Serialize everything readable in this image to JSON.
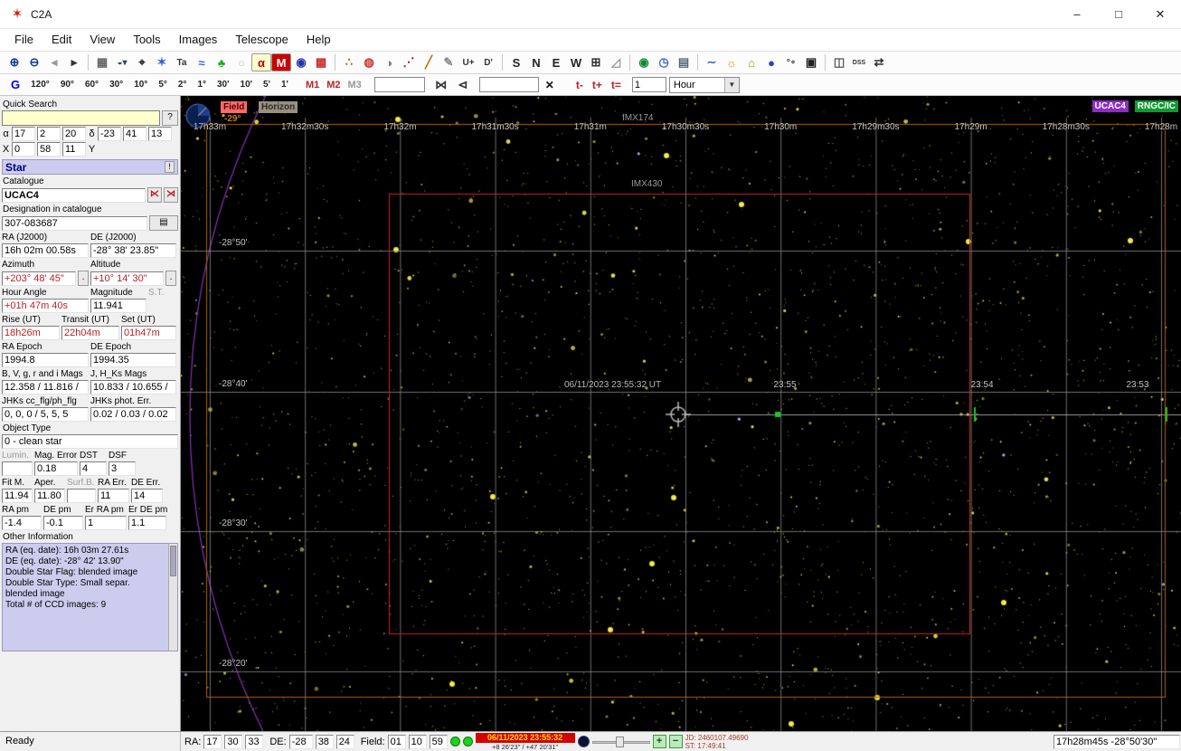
{
  "window": {
    "title": "C2A",
    "controls": {
      "minimize": "–",
      "maximize": "□",
      "close": "✕"
    }
  },
  "menu": {
    "items": [
      "File",
      "Edit",
      "View",
      "Tools",
      "Images",
      "Telescope",
      "Help"
    ]
  },
  "toolbar": {
    "icons": [
      {
        "n": "zoom-in-icon",
        "g": "⊕",
        "c": "#1a3c8f"
      },
      {
        "n": "zoom-out-icon",
        "g": "⊖",
        "c": "#1a3c8f"
      },
      {
        "n": "back-icon",
        "g": "◂",
        "c": "#999"
      },
      {
        "n": "forward-icon",
        "g": "▸",
        "c": "#333"
      },
      {
        "sep": true
      },
      {
        "n": "grid-icon",
        "g": "▦",
        "c": "#666"
      },
      {
        "n": "sky-display-icon",
        "g": "◒▾",
        "c": "#344a66"
      },
      {
        "n": "center-target-icon",
        "g": "⌖",
        "c": "#222"
      },
      {
        "n": "star-settings-icon",
        "g": "✶",
        "c": "#3366cc"
      },
      {
        "n": "labels-icon",
        "g": "Ta",
        "c": "#333"
      },
      {
        "n": "chart-icon",
        "g": "≈",
        "c": "#3366cc"
      },
      {
        "n": "landscape-icon",
        "g": "♣",
        "c": "#22aa22"
      },
      {
        "n": "ellipse-icon",
        "g": "○",
        "c": "#bbb"
      },
      {
        "n": "greek-alpha-icon",
        "g": "α",
        "c": "#bb0000",
        "bg": "#ffffcc"
      },
      {
        "n": "messier-icon",
        "g": "M",
        "c": "#fff",
        "bg": "#cc0000"
      },
      {
        "n": "globe-icon",
        "g": "◉",
        "c": "#2233aa"
      },
      {
        "n": "checkerboard-icon",
        "g": "▩",
        "c": "#cc3333"
      },
      {
        "sep": true
      },
      {
        "n": "scatter-dots-icon",
        "g": "∴",
        "c": "#996633"
      },
      {
        "n": "planet-icon",
        "g": "◍",
        "c": "#cc3333"
      },
      {
        "n": "moon-phase-icon",
        "g": "◑",
        "c": "#777"
      },
      {
        "n": "track-dots-icon",
        "g": "⋰",
        "c": "#cc0000"
      },
      {
        "n": "comet-icon",
        "g": "╱",
        "c": "#cc6600"
      },
      {
        "n": "pen-icon",
        "g": "✎",
        "c": "#888"
      },
      {
        "n": "u-plus-icon",
        "g": "U+",
        "c": "#333"
      },
      {
        "n": "d-prime-icon",
        "g": "D'",
        "c": "#333"
      },
      {
        "sep": true
      },
      {
        "n": "south-icon",
        "g": "S",
        "c": "#222"
      },
      {
        "n": "north-icon",
        "g": "N",
        "c": "#222"
      },
      {
        "n": "east-icon",
        "g": "E",
        "c": "#222"
      },
      {
        "n": "west-icon",
        "g": "W",
        "c": "#222"
      },
      {
        "n": "center-field-icon",
        "g": "⊞",
        "c": "#333"
      },
      {
        "n": "ruler-icon",
        "g": "◿",
        "c": "#999"
      },
      {
        "sep": true
      },
      {
        "n": "earth-icon",
        "g": "◉",
        "c": "#118833"
      },
      {
        "n": "clock-icon",
        "g": "◷",
        "c": "#3366cc"
      },
      {
        "n": "ephemeris-panel-icon",
        "g": "▤",
        "c": "#556677"
      },
      {
        "sep": true
      },
      {
        "n": "wave-icon",
        "g": "∼",
        "c": "#3366cc"
      },
      {
        "n": "sun-icon",
        "g": "☼",
        "c": "#ee8800"
      },
      {
        "n": "dome-icon",
        "g": "⌂",
        "c": "#aa8800"
      },
      {
        "n": "sphere-icon",
        "g": "●",
        "c": "#2244cc"
      },
      {
        "n": "degrees-icon",
        "g": "°∘",
        "c": "#333"
      },
      {
        "n": "camera-icon",
        "g": "▣",
        "c": "#222"
      },
      {
        "sep": true
      },
      {
        "n": "images-icon",
        "g": "◫",
        "c": "#555"
      },
      {
        "n": "dss-icon",
        "g": "DSS",
        "c": "#333"
      },
      {
        "n": "connect-icon",
        "g": "⇄",
        "c": "#333"
      }
    ]
  },
  "toolbar2": {
    "g_label": "G",
    "fov": [
      "120°",
      "90°",
      "60°",
      "30°",
      "10°",
      "5°",
      "2°",
      "1°",
      "30'",
      "10'",
      "5'",
      "1'"
    ],
    "m_buttons": [
      {
        "label": "M1",
        "color": "#bb2222"
      },
      {
        "label": "M2",
        "color": "#bb2222"
      },
      {
        "label": "M3",
        "color": "#999999"
      }
    ],
    "search1": "",
    "mirror_icons": [
      {
        "n": "mirror-horizontal-icon",
        "g": "⋈",
        "c": "#333"
      },
      {
        "n": "mirror-vertical-icon",
        "g": "⊲",
        "c": "#333"
      }
    ],
    "search2": "",
    "clear_label": "✕",
    "time_buttons": [
      "t-",
      "t+",
      "t="
    ],
    "step_value": "1",
    "step_unit": "Hour"
  },
  "sidebar": {
    "quick_search": {
      "label": "Quick Search",
      "value": "",
      "help": "?"
    },
    "pos": {
      "alpha_label": "α",
      "alpha": [
        "17",
        "2",
        "20"
      ],
      "delta_label": "δ",
      "delta": [
        "-23",
        "41",
        "13"
      ],
      "x_label": "X",
      "x": [
        "0",
        "58",
        "11"
      ],
      "y_label": "Y"
    },
    "star": {
      "header": "Star",
      "pin": "!"
    },
    "catalogue": {
      "label": "Catalogue",
      "value": "UCAC4",
      "prev": "⋉",
      "next": "⋊"
    },
    "designation": {
      "label": "Designation in catalogue",
      "value": "307-083687",
      "print": "▤"
    },
    "radec": {
      "ra_label": "RA (J2000)",
      "de_label": "DE (J2000)",
      "ra": "16h 02m 00.58s",
      "de": "-28° 38' 23.85\""
    },
    "azalt": {
      "az_label": "Azimuth",
      "alt_label": "Altitude",
      "az": "+203° 48' 45\"",
      "alt": "+10° 14' 30\"",
      "more": "."
    },
    "hamag": {
      "ha_label": "Hour Angle",
      "mag_label": "Magnitude",
      "st_label": "S.T.",
      "ha": "+01h 47m 40s",
      "mag": "11.941"
    },
    "rts": {
      "rise_label": "Rise (UT)",
      "transit_label": "Transit (UT)",
      "set_label": "Set (UT)",
      "rise": "18h26m",
      "transit": "22h04m",
      "set": "01h47m"
    },
    "epoch": {
      "ra_label": "RA Epoch",
      "de_label": "DE Epoch",
      "ra": "1994.8",
      "de": "1994.35"
    },
    "mags": {
      "bvgri_label": "B, V, g, r and i Mags",
      "jhks_label": "J, H_Ks Mags",
      "bvgri": "12.358 / 11.816 /",
      "jhks": "10.833 / 10.655 /"
    },
    "jhks": {
      "cc_label": "JHKs cc_flg/ph_flg",
      "err_label": "JHKs phot. Err.",
      "cc": "0, 0, 0 / 5, 5, 5",
      "err": "0.02 / 0.03 / 0.02"
    },
    "objtype": {
      "label": "Object Type",
      "value": "0 - clean star"
    },
    "row1": {
      "lumin_label": "Lumin.",
      "magerr_label": "Mag. Error",
      "dst_label": "DST",
      "dsf_label": "DSF",
      "lumin": "",
      "magerr": "0.18",
      "dst": "4",
      "dsf": "3"
    },
    "row2": {
      "fitm_label": "Fit M.",
      "aper_label": "Aper.",
      "surfb_label": "Surf.B.",
      "raerr_label": "RA Err.",
      "deerr_label": "DE Err.",
      "fitm": "11.94",
      "aper": "11.80",
      "surfb": "",
      "raerr": "11",
      "deerr": "14"
    },
    "row3": {
      "rapm_label": "RA pm",
      "depm_label": "DE pm",
      "errapm_label": "Er RA pm",
      "erdepm_label": "Er DE pm",
      "rapm": "-1.4",
      "depm": "-0.1",
      "errapm": "1",
      "erdepm": "1.1"
    },
    "other": {
      "label": "Other Information",
      "lines": [
        "RA (eq. date): 16h 03m 27.61s",
        "DE (eq. date): -28° 42' 13.90\"",
        "Double Star Flag: blended image",
        "Double Star Type: Small separ.",
        "blended image",
        "Total # of CCD images: 9"
      ]
    }
  },
  "chart": {
    "field_badge": "Field",
    "horizon_badge": "Horizon",
    "altitude": "-29°",
    "badges": {
      "ucac4": "UCAC4",
      "rngc": "RNGC/IC"
    },
    "sensors": {
      "imx174": "IMX174",
      "imx430": "IMX430"
    },
    "ra_labels": [
      "17h33m",
      "17h32m30s",
      "17h32m",
      "17h31m30s",
      "17h31m",
      "17h30m30s",
      "17h30m",
      "17h29m30s",
      "17h29m",
      "17h28m30s",
      "17h28m"
    ],
    "dec_labels": [
      "-28°50'",
      "-28°40'",
      "-28°30'",
      "-28°20'"
    ],
    "center_time": "06/11/2023 23:55:32 UT",
    "ticks": [
      "23:55",
      "23:54",
      "23:53"
    ],
    "colors": {
      "star": "#eadf3e",
      "grid": "#919191",
      "field_rect": "#b25f00",
      "sensor_rect": "#cf2121",
      "horizon_circle": "#7b2fa8",
      "tick": "#18c428"
    }
  },
  "statusbar": {
    "ready": "Ready",
    "ra_label": "RA:",
    "ra": [
      "17",
      "30",
      "33"
    ],
    "de_label": "DE:",
    "de": [
      "-28",
      "38",
      "24"
    ],
    "field_label": "Field:",
    "field": [
      "01",
      "10",
      "59"
    ],
    "datetime": "06/11/2023 23:55:32",
    "location": "+8 26'23\" / +47 20'31\"",
    "step_increase": "+",
    "step_decrease": "−",
    "jd": "JD: 2460107.49690",
    "st": "ST: 17:49:41",
    "position": "17h28m45s  -28°50'30\""
  }
}
